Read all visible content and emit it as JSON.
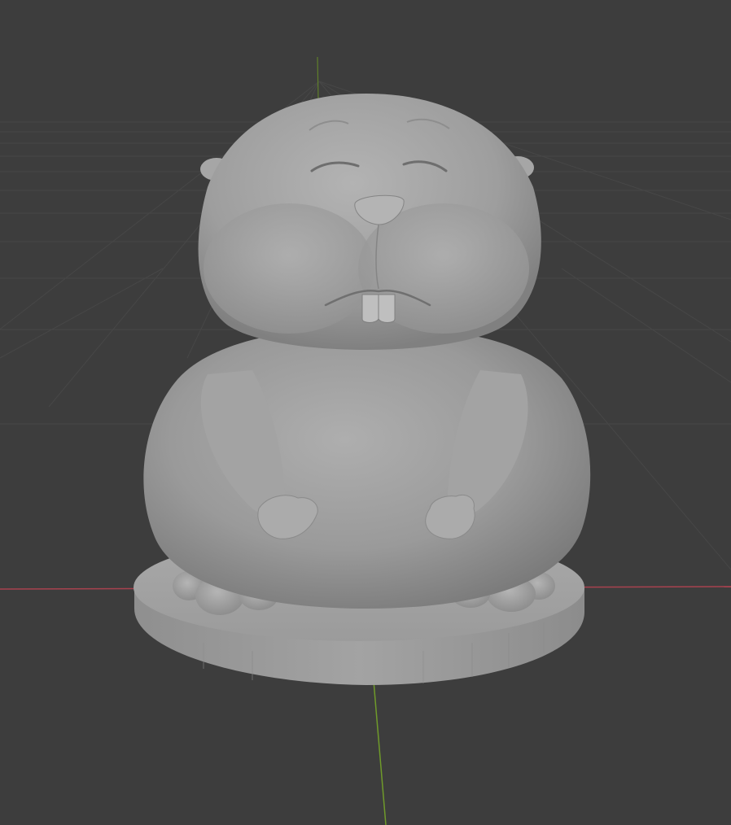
{
  "viewport": {
    "background_color": "#3d3d3d",
    "grid_color": "#4a4a4a",
    "x_axis_color": "#a8424f",
    "y_axis_color": "#6f9a2a",
    "z_axis_color": "#5f7f2a"
  },
  "model": {
    "base_color": "#a4a4a4",
    "body_color": "#9c9c9c",
    "shading_color": "#7c7c7c",
    "highlight_color": "#b9b9b9"
  }
}
